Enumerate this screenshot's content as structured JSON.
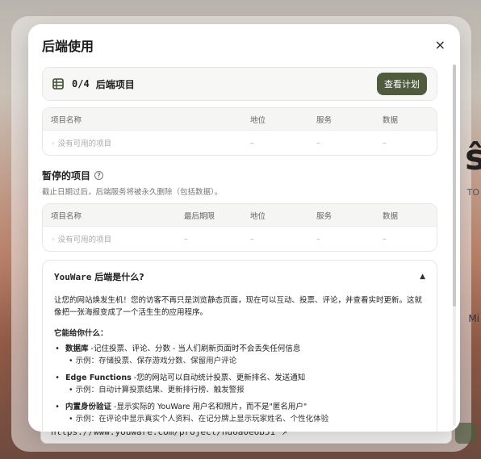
{
  "background": {
    "right_glyph": "ŝ",
    "right_text_1": "TO",
    "right_text_2": "Mi",
    "url": "https://www.youware.com/project/nd6a0e6b51"
  },
  "modal": {
    "title": "后端使用",
    "close_label": "×",
    "active": {
      "count": "0/4",
      "label": "后端项目",
      "plan_button": "查看计划",
      "columns": [
        "项目名称",
        "地位",
        "服务",
        "数据"
      ],
      "empty_row": [
        "◦ 没有可用的项目",
        "–",
        "–",
        "–"
      ]
    },
    "paused": {
      "title": "暂停的项目",
      "help_icon": "?",
      "description": "截止日期过后，后端服务将被永久删除（包括数据）。",
      "columns": [
        "项目名称",
        "最后期限",
        "地位",
        "服务",
        "数据"
      ],
      "empty_row": [
        "◦ 没有可用的项目",
        "–",
        "–",
        "–",
        "–"
      ]
    },
    "about": {
      "title_brand": "YouWare",
      "title_rest": " 后端是什么?",
      "toggle": "▲",
      "intro": "让您的网站焕发生机！您的访客不再只是浏览静态页面，现在可以互动、投票、评论，并查看实时更新。这就像把一张海报变成了一个活生生的应用程序。",
      "capabilities_title": "它能给你什么：",
      "features": [
        {
          "name": "数据库",
          "desc": " -记住投票、评论、分数 - 当人们刷新页面时不会丢失任何信息",
          "example": "• 示例：存储投票、保存游戏分数、保留用户评论"
        },
        {
          "name": "Edge Functions",
          "desc": " -您的网站可以自动统计投票、更新排名、发送通知",
          "example": "• 示例：自动计算投票结果、更新排行榜、触发警报"
        },
        {
          "name": "内置身份验证",
          "desc": " -显示实际的 YouWare 用户名和照片，而不是\"匿名用户\"",
          "example": "• 示例：在评论中显示真实个人资料、在记分牌上显示玩家姓名、个性化体验"
        }
      ]
    }
  },
  "colors": {
    "accent": "#4f5b3c",
    "muted_text": "#777777"
  },
  "icons": {
    "db": "database-icon",
    "close": "close-icon",
    "help": "help-icon",
    "external": "external-link-icon"
  }
}
